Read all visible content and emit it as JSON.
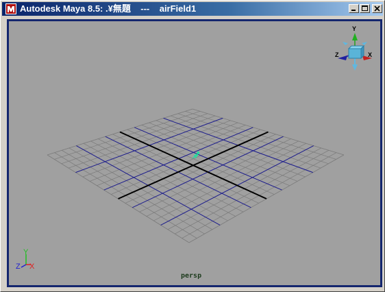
{
  "window": {
    "title": "Autodesk Maya 8.5: .¥無題    ---    airField1"
  },
  "viewport": {
    "camera_label": "persp",
    "view_cube": {
      "y": "Y",
      "x": "X",
      "z": "Z"
    },
    "axis_indicator": {
      "y": "Y",
      "x": "X",
      "z": "Z"
    }
  },
  "colors": {
    "background": "#a0a0a0",
    "grid_minor": "#7a7a7a",
    "grid_major": "#1a1a8c",
    "axis_line": "#000000",
    "viewport_border": "#14266e",
    "x_axis": "#e02020",
    "y_axis": "#20c020",
    "z_axis": "#2020d0"
  },
  "icons": [
    "maya-app-icon",
    "minimize-icon",
    "maximize-icon",
    "close-icon",
    "view-cube-icon",
    "field-manipulator-icon"
  ]
}
